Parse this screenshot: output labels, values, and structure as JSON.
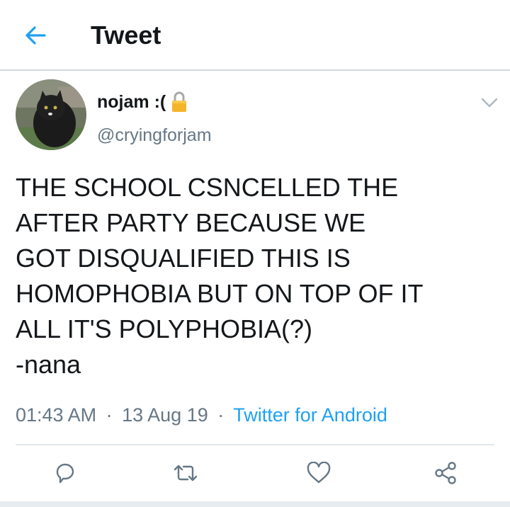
{
  "header": {
    "title": "Tweet",
    "back_icon": "arrow-left-icon",
    "accent": "#1da1f2"
  },
  "tweet": {
    "author": {
      "display_name": "nojam :(",
      "handle": "@cryingforjam",
      "protected_icon": "lock-icon"
    },
    "text_lines": [
      "THE SCHOOL CSNCELLED THE",
      "AFTER PARTY BECAUSE WE",
      "GOT DISQUALIFIED THIS IS",
      "HOMOPHOBIA BUT ON TOP OF IT",
      "ALL IT'S POLYPHOBIA(?)",
      "-nana"
    ],
    "time": "01:43 AM",
    "date": "13 Aug 19",
    "separator": "·",
    "source": "Twitter for Android"
  },
  "actions": [
    {
      "name": "reply",
      "icon": "reply-icon"
    },
    {
      "name": "retweet",
      "icon": "retweet-icon"
    },
    {
      "name": "like",
      "icon": "heart-icon"
    },
    {
      "name": "share",
      "icon": "share-icon"
    }
  ],
  "colors": {
    "text": "#14171a",
    "secondary": "#657786",
    "link": "#1da1f2",
    "border": "#e1e8ed"
  }
}
